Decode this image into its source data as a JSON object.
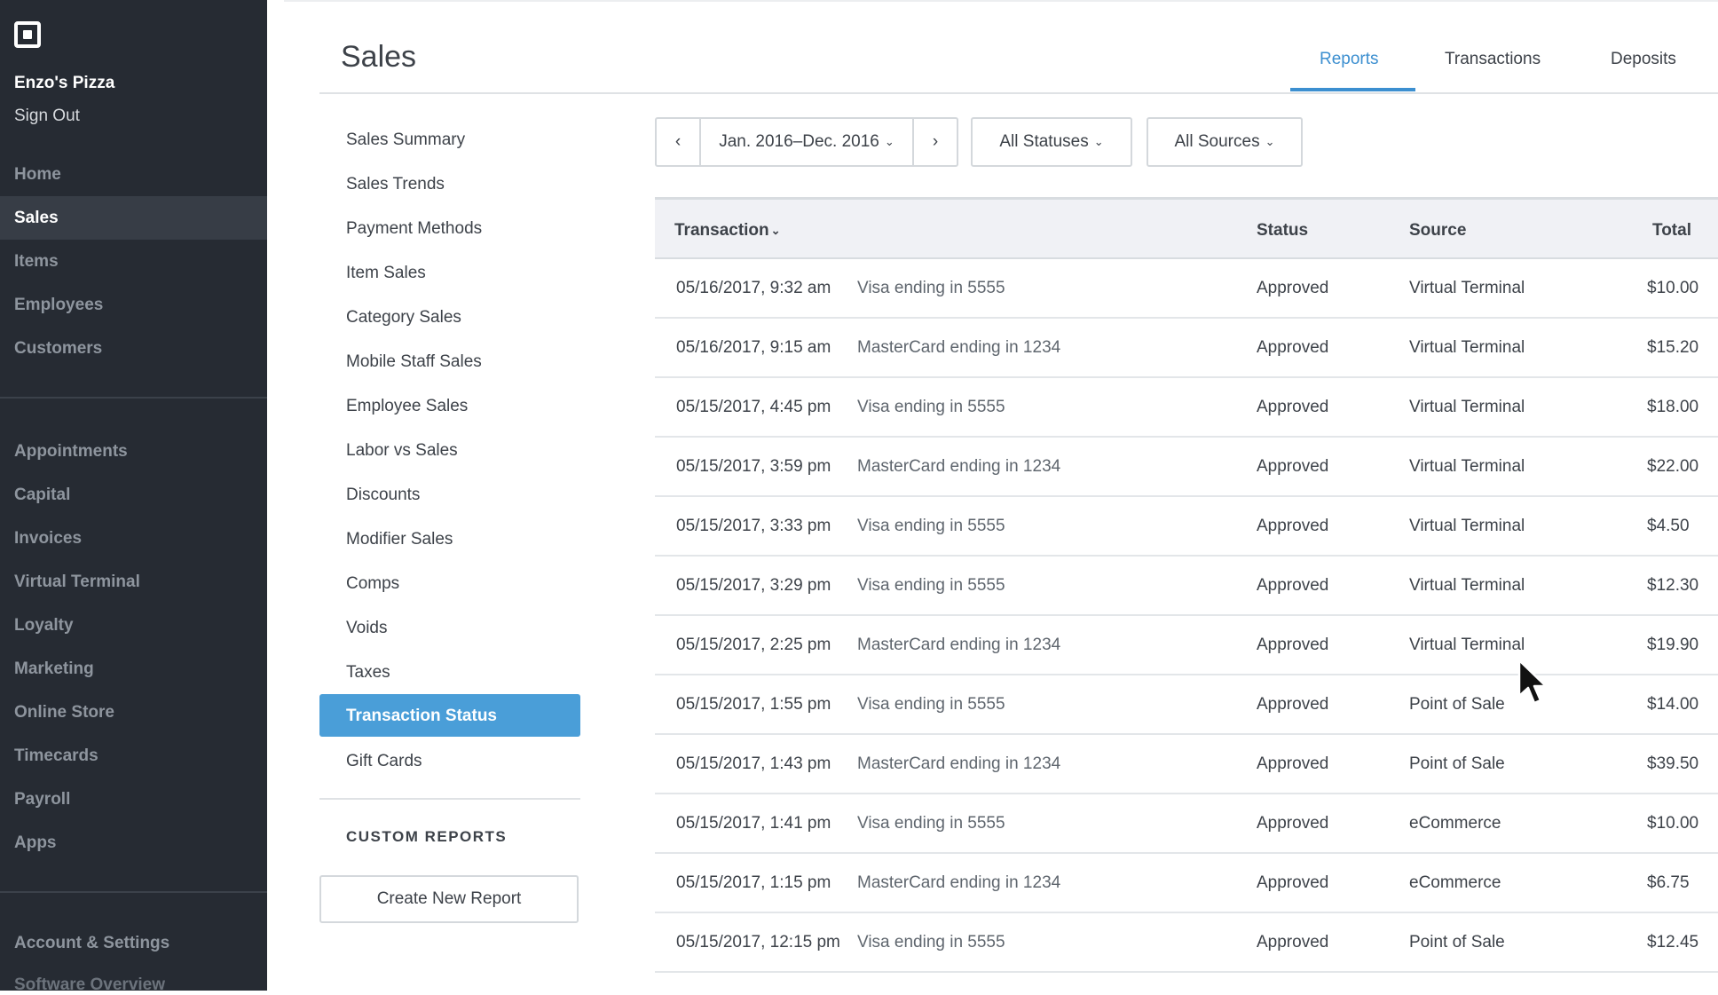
{
  "app": {
    "business_name": "Enzo's Pizza",
    "sign_out": "Sign Out",
    "nav_primary": [
      {
        "label": "Home"
      },
      {
        "label": "Sales"
      },
      {
        "label": "Items"
      },
      {
        "label": "Employees"
      },
      {
        "label": "Customers"
      }
    ],
    "nav_secondary": [
      {
        "label": "Appointments"
      },
      {
        "label": "Capital"
      },
      {
        "label": "Invoices"
      },
      {
        "label": "Virtual Terminal"
      },
      {
        "label": "Loyalty"
      },
      {
        "label": "Marketing"
      },
      {
        "label": "Online Store"
      },
      {
        "label": "Timecards"
      },
      {
        "label": "Payroll"
      },
      {
        "label": "Apps"
      }
    ],
    "account_settings": "Account & Settings",
    "software_overview": "Software Overview"
  },
  "header": {
    "title": "Sales",
    "tabs": [
      "Reports",
      "Transactions",
      "Deposits"
    ]
  },
  "reports": {
    "items": [
      "Sales Summary",
      "Sales Trends",
      "Payment Methods",
      "Item Sales",
      "Category Sales",
      "Mobile Staff Sales",
      "Employee Sales",
      "Labor vs Sales",
      "Discounts",
      "Modifier Sales",
      "Comps",
      "Voids",
      "Taxes"
    ],
    "active": "Transaction Status",
    "after": "Gift Cards",
    "custom_header": "CUSTOM REPORTS",
    "create_button": "Create New Report"
  },
  "filters": {
    "prev": "‹",
    "date_range": "Jan. 2016–Dec. 2016",
    "next": "›",
    "status": "All Statuses",
    "source": "All Sources"
  },
  "table": {
    "headers": {
      "transaction": "Transaction",
      "status": "Status",
      "source": "Source",
      "total": "Total"
    },
    "rows": [
      {
        "date": "05/16/2017,  9:32 am",
        "card": "Visa ending in 5555",
        "status": "Approved",
        "source": "Virtual Terminal",
        "total": "$10.00"
      },
      {
        "date": "05/16/2017,  9:15 am",
        "card": "MasterCard ending in 1234",
        "status": "Approved",
        "source": "Virtual Terminal",
        "total": "$15.20"
      },
      {
        "date": "05/15/2017,  4:45 pm",
        "card": "Visa ending in 5555",
        "status": "Approved",
        "source": "Virtual Terminal",
        "total": "$18.00"
      },
      {
        "date": "05/15/2017,  3:59 pm",
        "card": "MasterCard ending in 1234",
        "status": "Approved",
        "source": "Virtual Terminal",
        "total": "$22.00"
      },
      {
        "date": "05/15/2017,  3:33 pm",
        "card": "Visa ending in 5555",
        "status": "Approved",
        "source": "Virtual Terminal",
        "total": "$4.50"
      },
      {
        "date": "05/15/2017,  3:29 pm",
        "card": "Visa ending in 5555",
        "status": "Approved",
        "source": "Virtual Terminal",
        "total": "$12.30"
      },
      {
        "date": "05/15/2017,  2:25 pm",
        "card": "MasterCard ending in 1234",
        "status": "Approved",
        "source": "Virtual Terminal",
        "total": "$19.90"
      },
      {
        "date": "05/15/2017,  1:55 pm",
        "card": "Visa ending in 5555",
        "status": "Approved",
        "source": "Point of Sale",
        "total": "$14.00"
      },
      {
        "date": "05/15/2017,  1:43 pm",
        "card": "MasterCard ending in 1234",
        "status": "Approved",
        "source": "Point of Sale",
        "total": "$39.50"
      },
      {
        "date": "05/15/2017,  1:41 pm",
        "card": "Visa ending in 5555",
        "status": "Approved",
        "source": "eCommerce",
        "total": "$10.00"
      },
      {
        "date": "05/15/2017,  1:15 pm",
        "card": "MasterCard ending in 1234",
        "status": "Approved",
        "source": "eCommerce",
        "total": "$6.75"
      },
      {
        "date": "05/15/2017,  12:15 pm",
        "card": "Visa ending in 5555",
        "status": "Approved",
        "source": "Point of Sale",
        "total": "$12.45"
      }
    ]
  },
  "colors": {
    "sidebar_bg": "#262b33",
    "accent": "#3c8fd0",
    "active_report_bg": "#4a9ed8"
  },
  "icons": {
    "logo": "square-logo-icon",
    "chevron": "chevron-down-icon",
    "cursor": "mouse-pointer-icon"
  }
}
